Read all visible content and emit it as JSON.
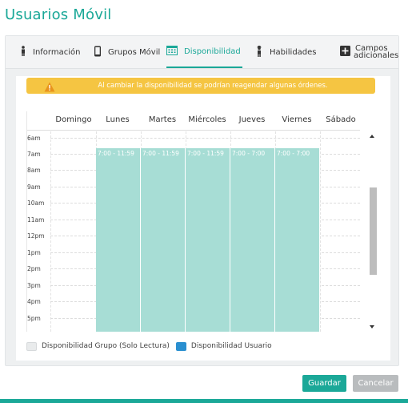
{
  "page": {
    "title": "Usuarios Móvil"
  },
  "tabs": [
    {
      "label": "Información",
      "icon": "person-icon"
    },
    {
      "label": "Grupos Móvil",
      "icon": "mobile-icon"
    },
    {
      "label": "Disponibilidad",
      "icon": "calendar-icon",
      "active": true
    },
    {
      "label": "Habilidades",
      "icon": "worker-icon"
    },
    {
      "label_line1": "Campos",
      "label_line2": "adicionales",
      "icon": "plus-square-icon"
    }
  ],
  "alert": {
    "text": "Al cambiar la disponibilidad se podrían reagendar algunas órdenes."
  },
  "calendar": {
    "days": [
      "Domingo",
      "Lunes",
      "Martes",
      "Miércoles",
      "Jueves",
      "Viernes",
      "Sábado"
    ],
    "hours": [
      "6am",
      "7am",
      "8am",
      "9am",
      "10am",
      "11am",
      "12pm",
      "1pm",
      "2pm",
      "3pm",
      "4pm",
      "5pm"
    ],
    "events": [
      {
        "day": "Lunes",
        "label": "7:00 - 11:59"
      },
      {
        "day": "Martes",
        "label": "7:00 - 11:59"
      },
      {
        "day": "Miércoles",
        "label": "7:00 - 11:59"
      },
      {
        "day": "Jueves",
        "label": "7:00 - 7:00"
      },
      {
        "day": "Viernes",
        "label": "7:00 - 7:00"
      }
    ]
  },
  "legend": {
    "group": "Disponibilidad Grupo (Solo Lectura)",
    "user": "Disponibilidad Usuario"
  },
  "colors": {
    "accent": "#1ba898",
    "alert": "#f5c542",
    "event": "#a7ddd5",
    "user_swatch": "#2a8fd0"
  },
  "buttons": {
    "save": "Guardar",
    "cancel": "Cancelar"
  }
}
